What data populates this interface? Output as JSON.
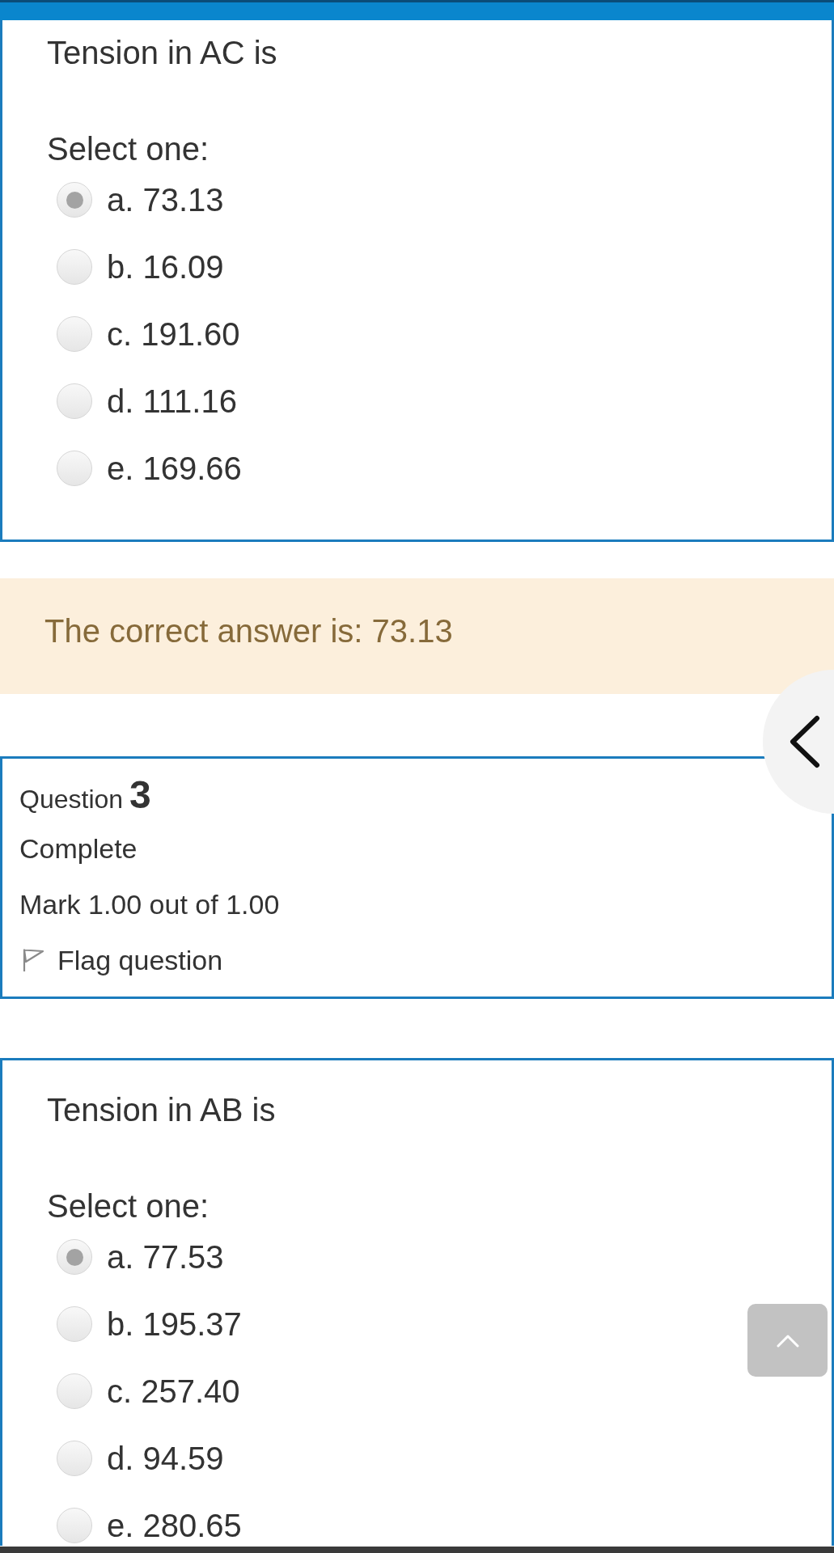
{
  "blocks": [
    {
      "kind": "answer",
      "prompt": "Tension in AC is",
      "instruction": "Select one:",
      "options": [
        {
          "label": "a. 73.13",
          "selected": true
        },
        {
          "label": "b. 16.09",
          "selected": false
        },
        {
          "label": "c. 191.60",
          "selected": false
        },
        {
          "label": "d. 111.16",
          "selected": false
        },
        {
          "label": "e. 169.66",
          "selected": false
        }
      ]
    },
    {
      "kind": "feedback",
      "text": "The correct answer is: 73.13"
    },
    {
      "kind": "info",
      "label": "Question",
      "number": "3",
      "status": "Complete",
      "mark": "Mark 1.00 out of 1.00",
      "flag": {
        "label": "Flag question",
        "flagged": false
      }
    },
    {
      "kind": "answer",
      "prompt": "Tension in AB is",
      "instruction": "Select one:",
      "options": [
        {
          "label": "a. 77.53",
          "selected": true
        },
        {
          "label": "b. 195.37",
          "selected": false
        },
        {
          "label": "c. 257.40",
          "selected": false
        },
        {
          "label": "d. 94.59",
          "selected": false
        },
        {
          "label": "e. 280.65",
          "selected": false
        }
      ]
    }
  ]
}
